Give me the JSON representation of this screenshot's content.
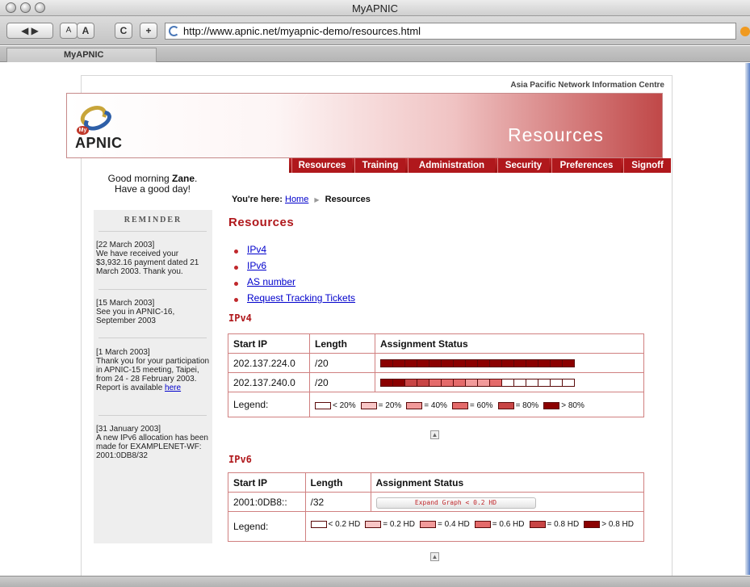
{
  "window": {
    "title": "MyAPNIC"
  },
  "toolbar": {
    "back_label": "◀ ▶",
    "smaller_text_label": "A",
    "larger_text_label": "A",
    "reload_label": "C",
    "add_bookmark_label": "+",
    "url": "http://www.apnic.net/myapnic-demo/resources.html"
  },
  "tab": {
    "label": "MyAPNIC"
  },
  "header": {
    "org_name": "Asia Pacific Network Information Centre",
    "logo_badge": "My",
    "logo_text": "APNIC",
    "banner_title": "Resources"
  },
  "nav": {
    "items": [
      {
        "label": "Resources"
      },
      {
        "label": "Training"
      },
      {
        "label": "Administration"
      },
      {
        "label": "Security"
      },
      {
        "label": "Preferences"
      },
      {
        "label": "Signoff"
      }
    ]
  },
  "sidebar": {
    "greeting_prefix": "Good morning",
    "user_name": "Zane",
    "greeting_suffix": ".",
    "greeting_line2": "Have a good day!",
    "reminder_title": "REMINDER",
    "reminders": [
      {
        "date": "[22 March 2003]",
        "text": "We have received your $3,932.16 payment dated 21 March 2003. Thank you."
      },
      {
        "date": "[15 March 2003]",
        "text": "See you in APNIC-16, September 2003"
      },
      {
        "date": "[1 March 2003]",
        "text": "Thank you for your participation in APNIC-15 meeting, Taipei, from 24 - 28 February 2003. Report is available",
        "link": "here"
      },
      {
        "date": "[31 January 2003]",
        "text": "A new IPv6 allocation has been made for EXAMPLENET-WF: 2001:0DB8/32"
      }
    ]
  },
  "breadcrumb": {
    "prefix": "You're here:",
    "home": "Home",
    "current": "Resources"
  },
  "main": {
    "heading": "Resources",
    "links": [
      "IPv4",
      "IPv6",
      "AS number",
      "Request Tracking Tickets"
    ]
  },
  "ipv4": {
    "heading": "IPv4",
    "columns": [
      "Start IP",
      "Length",
      "Assignment Status"
    ],
    "rows": [
      {
        "start_ip": "202.137.224.0",
        "length": "/20",
        "segments": [
          5,
          5,
          5,
          5,
          5,
          5,
          5,
          5,
          5,
          5,
          5,
          5,
          5,
          5,
          5,
          5
        ]
      },
      {
        "start_ip": "202.137.240.0",
        "length": "/20",
        "segments": [
          5,
          5,
          4,
          4,
          3,
          3,
          3,
          2,
          2,
          3,
          0,
          0,
          0,
          0,
          0,
          0
        ]
      }
    ],
    "legend_label": "Legend:",
    "legend": [
      {
        "label": "< 20%",
        "level": 0
      },
      {
        "label": "= 20%",
        "level": 1
      },
      {
        "label": "= 40%",
        "level": 2
      },
      {
        "label": "= 60%",
        "level": 3
      },
      {
        "label": "= 80%",
        "level": 4
      },
      {
        "label": "> 80%",
        "level": 5
      }
    ]
  },
  "ipv6": {
    "heading": "IPv6",
    "columns": [
      "Start IP",
      "Length",
      "Assignment Status"
    ],
    "rows": [
      {
        "start_ip": "2001:0DB8::",
        "length": "/32",
        "expand_label": "Expand Graph < 0.2 HD"
      }
    ],
    "legend_label": "Legend:",
    "legend": [
      {
        "label": "< 0.2 HD",
        "level": 0
      },
      {
        "label": "= 0.2 HD",
        "level": 1
      },
      {
        "label": "= 0.4 HD",
        "level": 2
      },
      {
        "label": "= 0.6 HD",
        "level": 3
      },
      {
        "label": "= 0.8 HD",
        "level": 4
      },
      {
        "label": "> 0.8 HD",
        "level": 5
      }
    ]
  },
  "colors": {
    "levels": [
      "#ffffff",
      "#f8c6c6",
      "#f19a9a",
      "#e46a6a",
      "#c84545",
      "#8b0000"
    ],
    "accent": "#b0181c"
  },
  "top_arrow_icon": "arrow-up-icon"
}
